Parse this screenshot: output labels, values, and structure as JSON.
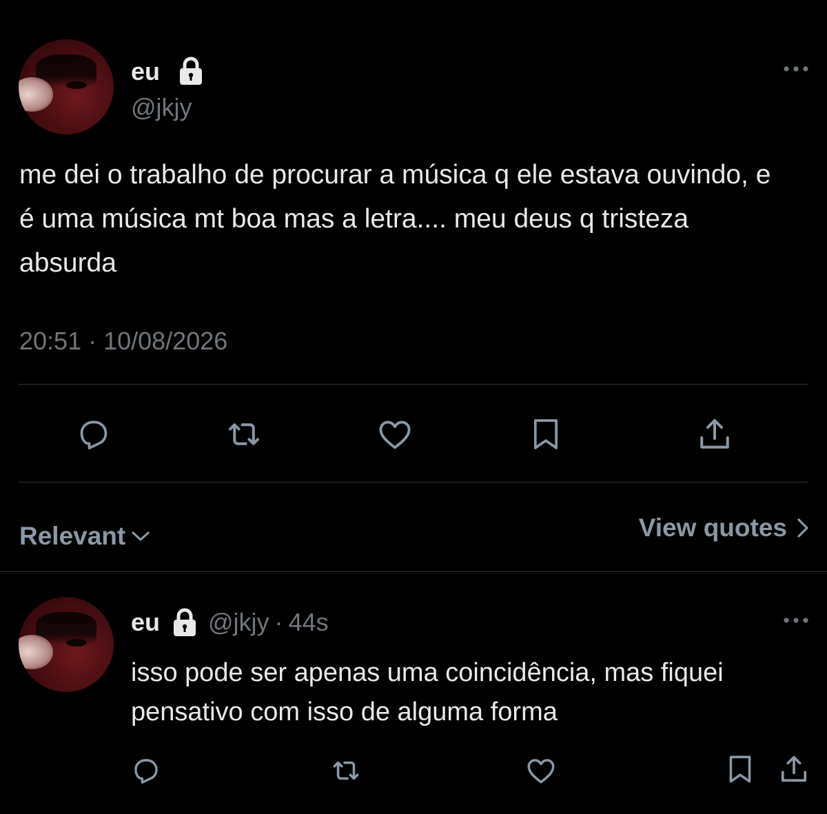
{
  "tweet": {
    "author_name": "eu",
    "handle": "@jkjy",
    "text": "me dei o trabalho de procurar a música q ele estava ouvindo, e é uma música mt boa mas a letra.... meu deus q tristeza absurda",
    "timestamp": "20:51 · 10/08/2026",
    "more_icon": "more-dots-icon",
    "lock_icon": "lock-icon",
    "actions": [
      "reply-icon",
      "retweet-icon",
      "like-icon",
      "bookmark-icon",
      "share-icon"
    ]
  },
  "replies_header": {
    "sort_label": "Relevant",
    "view_quotes_label": "View quotes"
  },
  "reply": {
    "author_name": "eu",
    "handle": "@jkjy",
    "separator": "·",
    "time": "44s",
    "text": "isso pode ser apenas uma coincidência, mas fiquei pensativo com isso de alguma forma",
    "actions": [
      "reply-icon",
      "retweet-icon",
      "like-icon",
      "bookmark-icon",
      "share-icon"
    ]
  },
  "colors": {
    "background": "#000000",
    "text": "#e7e9ea",
    "muted": "#71767b",
    "divider": "#2f3336",
    "secondary_label": "#8b98a5"
  }
}
